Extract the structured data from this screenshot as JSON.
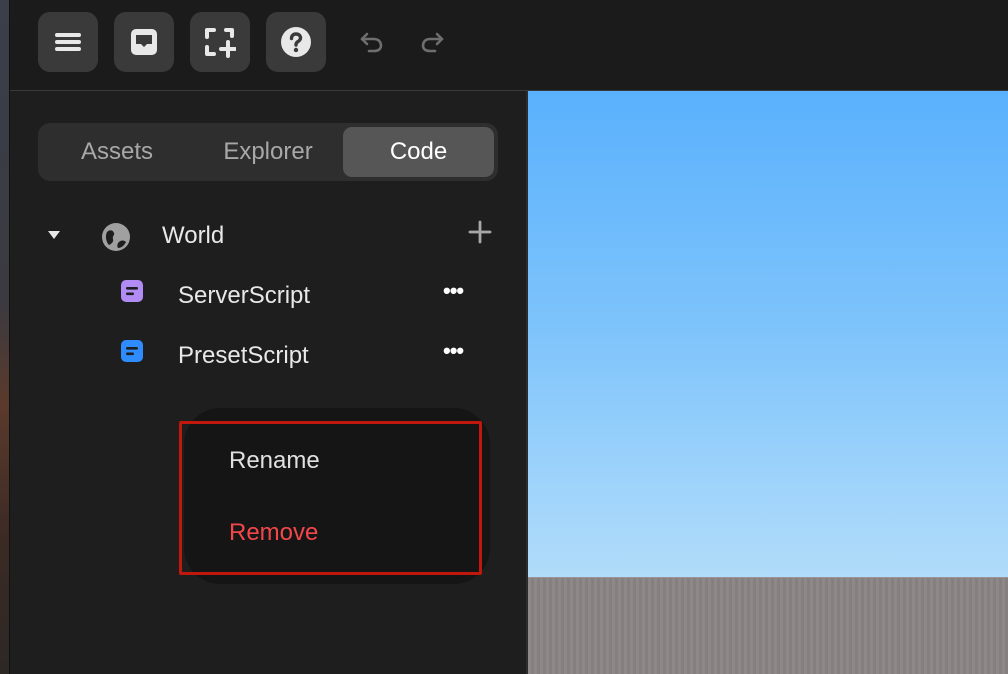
{
  "toolbar": {
    "buttons": [
      {
        "icon": "menu-icon"
      },
      {
        "icon": "inbox-icon"
      },
      {
        "icon": "frame-add-icon"
      },
      {
        "icon": "help-icon"
      },
      {
        "icon": "undo-icon"
      },
      {
        "icon": "redo-icon"
      }
    ]
  },
  "tabs": {
    "items": [
      {
        "label": "Assets"
      },
      {
        "label": "Explorer"
      },
      {
        "label": "Code"
      }
    ],
    "active": "Code"
  },
  "tree": {
    "root": {
      "label": "World",
      "icon": "globe-icon",
      "expanded": true
    },
    "scripts": [
      {
        "label": "ServerScript",
        "icon_color": "#b18cf5",
        "more": "•••"
      },
      {
        "label": "PresetScript",
        "icon_color": "#2f8cff",
        "more": "•••"
      }
    ]
  },
  "context_menu": {
    "items": [
      {
        "label": "Rename",
        "color": "#e0e0e0"
      },
      {
        "label": "Remove",
        "color": "#f2474a"
      }
    ]
  },
  "colors": {
    "highlight_outline": "#c0180c",
    "sky_top": "#5ab1fd",
    "ground": "#8a8484"
  }
}
